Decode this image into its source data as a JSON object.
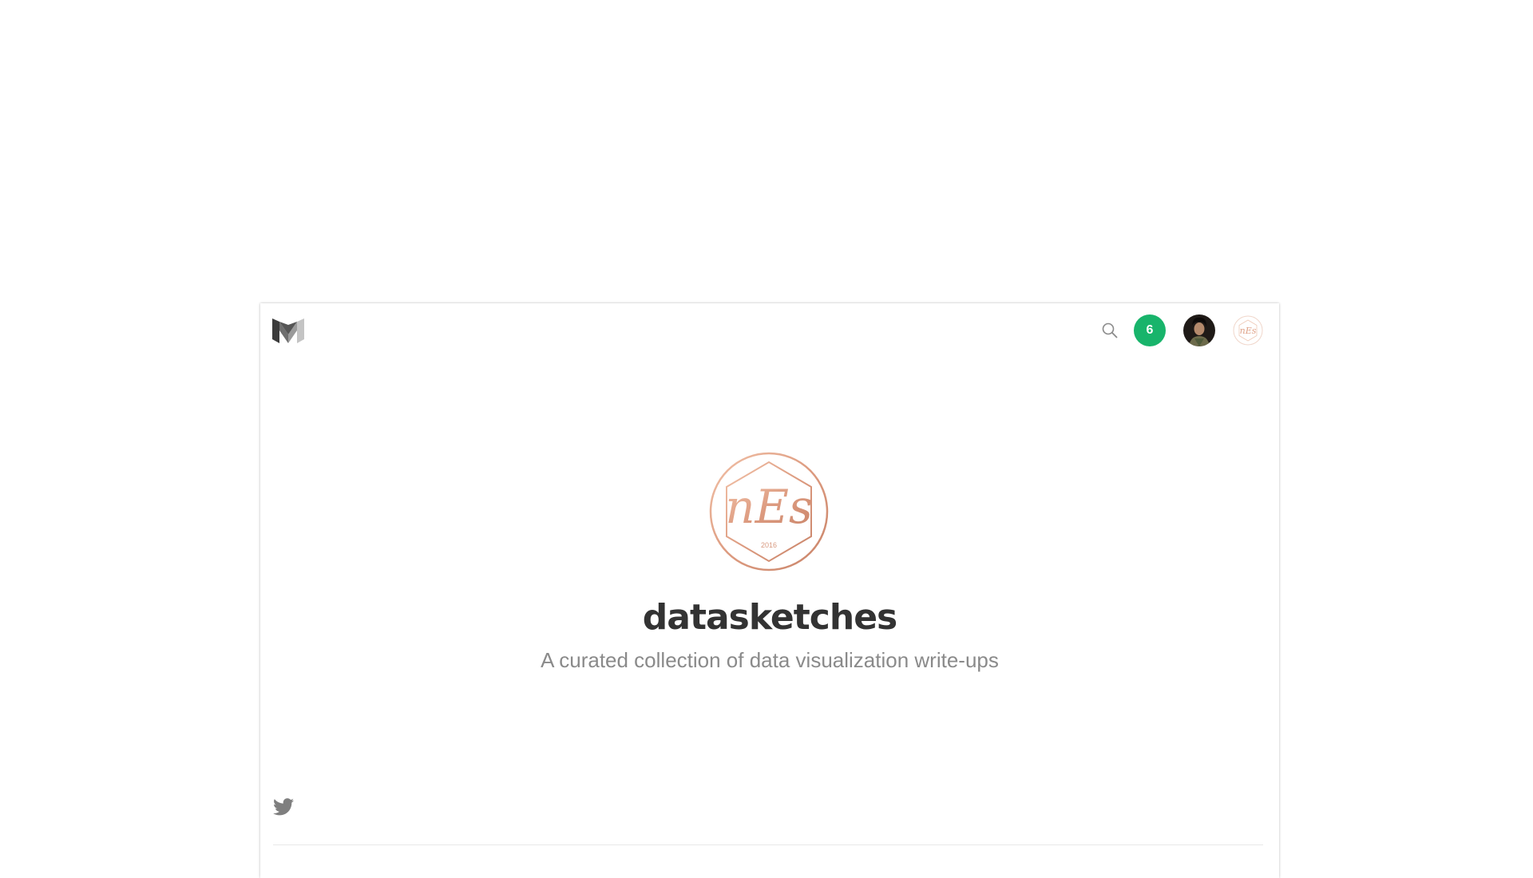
{
  "header": {
    "notification_count": "6",
    "accent_color": "#18b46b"
  },
  "publication": {
    "name": "datasketches",
    "tagline": "A curated collection of data visualization write-ups",
    "logo_text": "nEs",
    "logo_year": "2016",
    "logo_color": "#e0a48a"
  },
  "icons": {
    "brand": "medium-logo-icon",
    "search": "search-icon",
    "twitter": "twitter-icon"
  }
}
